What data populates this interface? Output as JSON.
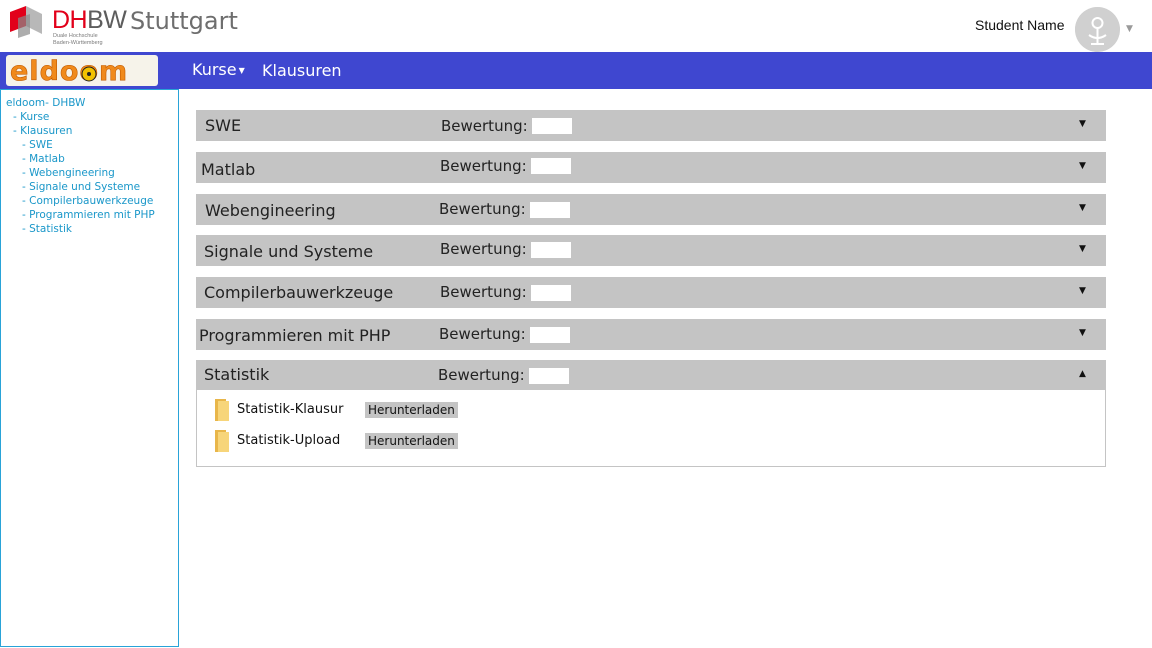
{
  "header": {
    "logo_dh": "DH",
    "logo_bw": "BW",
    "logo_sub_1": "Duale Hochschule",
    "logo_sub_2": "Baden-Württemberg",
    "city": "Stuttgart",
    "user_name": "Student Name"
  },
  "nav": {
    "brand": "eldoom",
    "kurse_label": "Kurse",
    "klausuren_label": "Klausuren"
  },
  "sidebar": {
    "root": "eldoom- DHBW",
    "kurse": "- Kurse",
    "klausuren": "- Klausuren",
    "items": [
      "- SWE",
      "- Matlab",
      "- Webengineering",
      "- Signale und Systeme",
      "- Compilerbauwerkzeuge",
      "- Programmieren mit PHP",
      "- Statistik"
    ]
  },
  "courses": [
    {
      "title": "SWE",
      "label": "Bewertung:",
      "score": ""
    },
    {
      "title": "Matlab",
      "label": "Bewertung:",
      "score": ""
    },
    {
      "title": "Webengineering",
      "label": "Bewertung:",
      "score": ""
    },
    {
      "title": "Signale und Systeme",
      "label": "Bewertung:",
      "score": ""
    },
    {
      "title": "Compilerbauwerkzeuge",
      "label": "Bewertung:",
      "score": ""
    },
    {
      "title": "Programmieren mit PHP",
      "label": "Bewertung:",
      "score": ""
    },
    {
      "title": "Statistik",
      "label": "Bewertung:",
      "score": ""
    }
  ],
  "statistik_files": [
    {
      "name": "Statistik-Klausur",
      "action": "Herunterladen"
    },
    {
      "name": "Statistik-Upload",
      "action": "Herunterladen"
    }
  ],
  "colors": {
    "navbar": "#3f47d0",
    "dhbw_red": "#e2001a",
    "accordion": "#c4c4c4",
    "sidebar_border": "#29a3d8",
    "sidebar_link": "#1a97c9"
  },
  "icons": {
    "collapsed": "caret-down-icon",
    "expanded": "caret-up-icon",
    "file": "folder-icon",
    "avatar": "user-avatar-icon"
  }
}
